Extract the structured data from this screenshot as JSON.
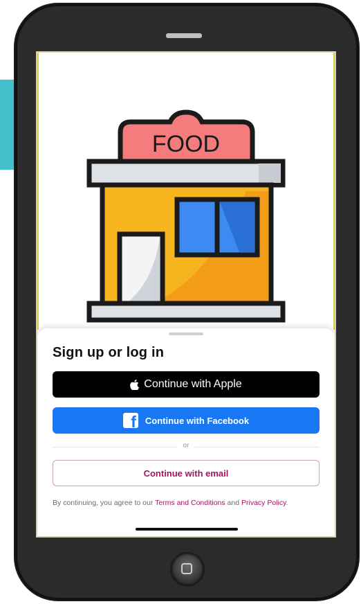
{
  "illustration": {
    "sign_text": "FOOD"
  },
  "sheet": {
    "title": "Sign up or log in",
    "apple_label": "Continue with Apple",
    "facebook_label": "Continue with Facebook",
    "separator": "or",
    "email_label": "Continue with email",
    "legal": {
      "prefix": "By continuing, you agree to our ",
      "terms_link": "Terms and Conditions",
      "middle": " and ",
      "privacy_link": "Privacy Policy",
      "suffix": "."
    }
  },
  "colors": {
    "apple_button": "#000000",
    "facebook_button": "#1877f2",
    "email_accent": "#a1155c",
    "teal_tab": "#44c0cd",
    "sign_pink": "#f47c7c",
    "store_yellow": "#f6b51e"
  },
  "icons": {
    "apple": "apple-logo-icon",
    "facebook": "facebook-logo-icon",
    "home": "home-button-icon"
  }
}
